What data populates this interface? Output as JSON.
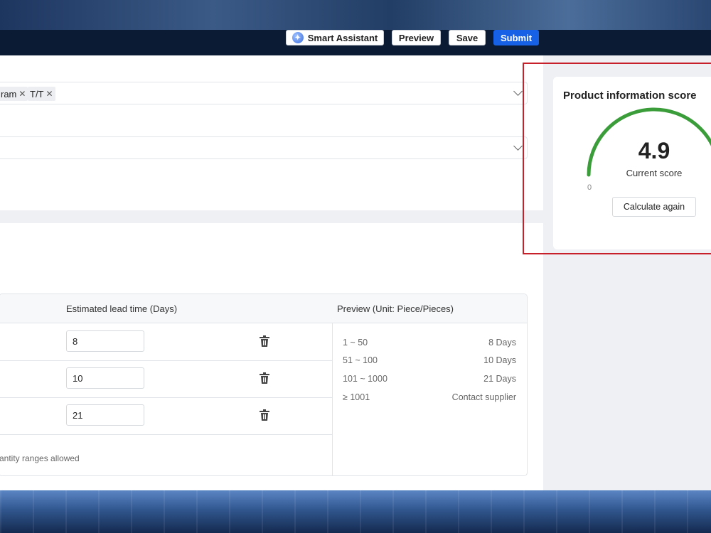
{
  "toolbar": {
    "smart_assistant": "Smart Assistant",
    "preview": "Preview",
    "save": "Save",
    "submit": "Submit"
  },
  "form": {
    "payment_tags": [
      "ram",
      "T/T"
    ]
  },
  "score": {
    "title": "Product information score",
    "value": "4.9",
    "label": "Current score",
    "min": "0",
    "button": "Calculate again",
    "fraction": 0.98,
    "color": "#3a9d3a"
  },
  "lead_time": {
    "col_lead": "Estimated lead time (Days)",
    "col_preview": "Preview (Unit: Piece/Pieces)",
    "rows": [
      {
        "days": "8"
      },
      {
        "days": "10"
      },
      {
        "days": "21"
      }
    ],
    "hint": "antity ranges allowed",
    "preview": [
      {
        "range": "1 ~ 50",
        "value": "8 Days"
      },
      {
        "range": "51 ~ 100",
        "value": "10 Days"
      },
      {
        "range": "101 ~ 1000",
        "value": "21 Days"
      },
      {
        "range": "≥ 1001",
        "value": "Contact supplier"
      }
    ]
  },
  "colors": {
    "primary": "#1661e6",
    "highlight_border": "#c8202a"
  }
}
